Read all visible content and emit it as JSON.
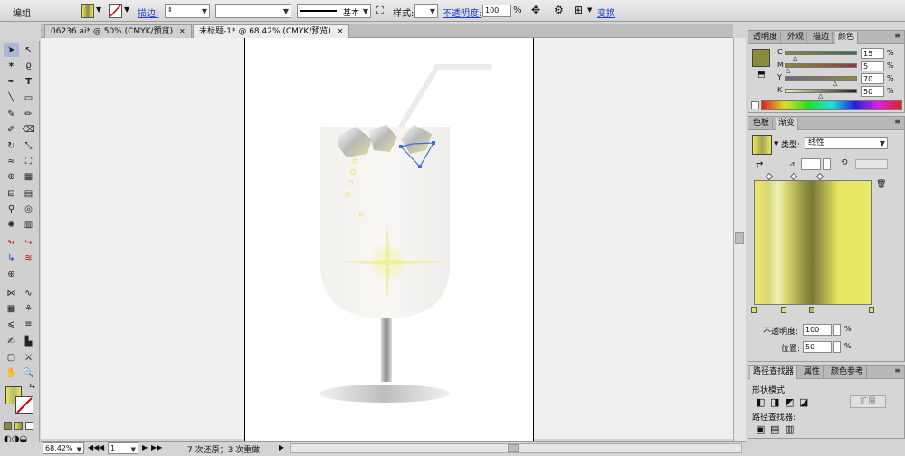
{
  "control_bar": {
    "mode_label": "编组",
    "stroke_label": "描边:",
    "stroke_profile": "基本",
    "style_label": "样式:",
    "opacity_label": "不透明度:",
    "opacity_value": "100",
    "opacity_unit": "%",
    "transform_label": "变换"
  },
  "doc_tabs": [
    {
      "label": "06236.ai* @ 50% (CMYK/预览)"
    },
    {
      "label": "未标题-1* @ 68.42% (CMYK/预览)"
    }
  ],
  "color_panel": {
    "tabs": [
      "透明度",
      "外观",
      "描边",
      "颜色"
    ],
    "channels": [
      {
        "name": "C",
        "value": "15",
        "unit": "%",
        "fill": 0.15
      },
      {
        "name": "M",
        "value": "5",
        "unit": "%",
        "fill": 0.05
      },
      {
        "name": "Y",
        "value": "70",
        "unit": "%",
        "fill": 0.7
      },
      {
        "name": "K",
        "value": "50",
        "unit": "%",
        "fill": 0.5
      }
    ]
  },
  "gradient_panel": {
    "tabs": [
      "色板",
      "渐变"
    ],
    "type_label": "类型:",
    "type_value": "线性",
    "opacity_label": "不透明度:",
    "opacity_value": "100",
    "opacity_unit": "%",
    "position_label": "位置:",
    "position_value": "50",
    "position_unit": "%"
  },
  "bottom_panel": {
    "tabs": [
      "路径查找器",
      "属性",
      "颜色参考"
    ],
    "shape_label": "形状模式:",
    "expand_label": "扩展",
    "pathfinder_label": "路径查找器:"
  },
  "status_bar": {
    "zoom": "68.42%",
    "page": "1",
    "status_text": "7 次还原；3 次重做"
  },
  "colors": {
    "fill_swatch": "#8c8a3c",
    "gradient_yellow": "#e6e660",
    "gradient_dark": "#7a7a3a"
  }
}
